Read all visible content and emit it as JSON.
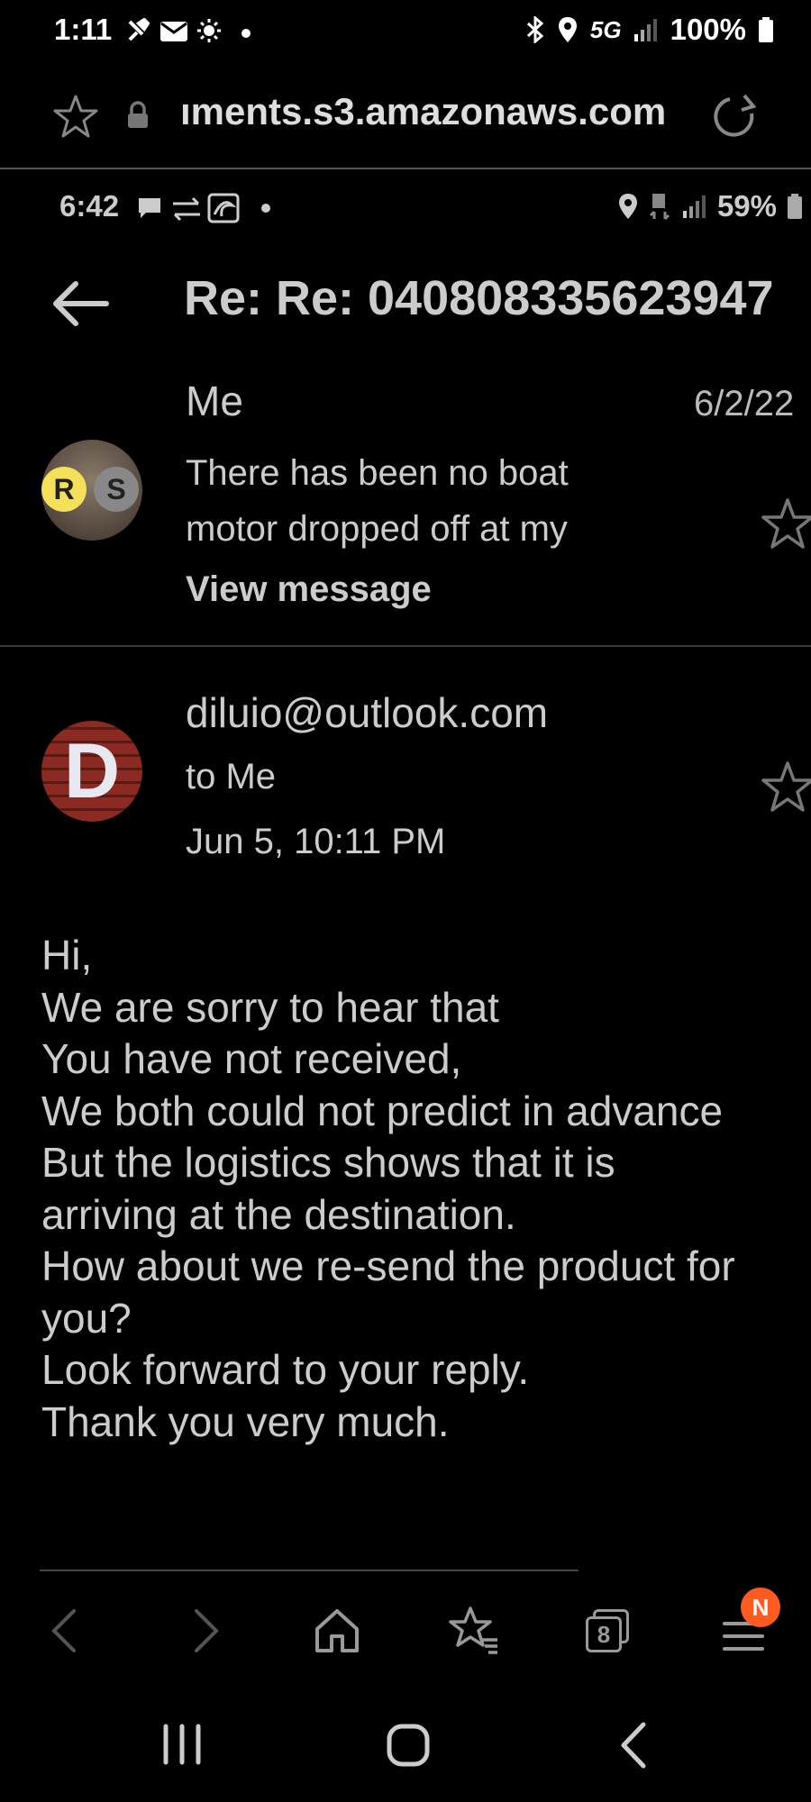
{
  "status_bar": {
    "time": "1:11",
    "network": "5G",
    "battery": "100%"
  },
  "browser": {
    "url": "ıments.s3.amazonaws.com"
  },
  "inner_status_bar": {
    "time": "6:42",
    "battery": "59%"
  },
  "email": {
    "subject": "Re: Re: 040808335623947",
    "message1": {
      "avatar_letters": [
        "R",
        "S"
      ],
      "sender": "Me",
      "date": "6/2/22",
      "snippet": "There has been no boat motor dropped off at my",
      "view_link": "View message"
    },
    "message2": {
      "avatar_letter": "D",
      "sender": "diluio@outlook.com",
      "to": "to  Me",
      "date": "Jun 5, 10:11 PM",
      "body_lines": [
        "Hi,",
        "We are sorry to hear that",
        "You have not received,",
        "We both could not predict in advance",
        "But the logistics shows that it is",
        "arriving at the destination.",
        "How about we re-send the product for",
        "you?",
        "Look forward to your reply.",
        "Thank you very much."
      ]
    }
  },
  "browser_nav": {
    "tab_count": "8",
    "menu_badge": "N"
  },
  "colors": {
    "badge": "#ff5a1f",
    "background": "#000000"
  }
}
